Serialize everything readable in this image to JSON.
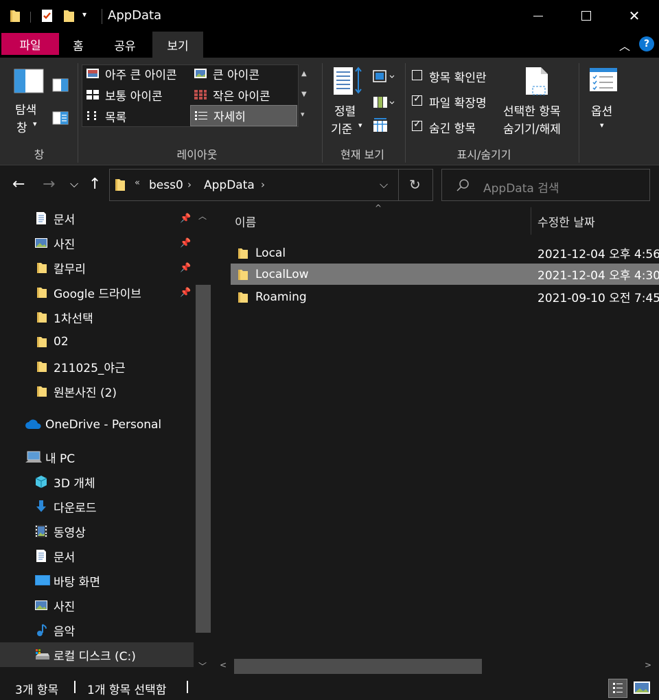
{
  "window": {
    "title": "AppData"
  },
  "ribbon_tabs": {
    "file": "파일",
    "home": "홈",
    "share": "공유",
    "view": "보기"
  },
  "ribbon": {
    "pane": {
      "label_line1": "탐색",
      "label_line2": "창",
      "group": "창"
    },
    "layout": {
      "group": "레이아웃",
      "items": [
        "아주 큰 아이콘",
        "큰 아이콘",
        "보통 아이콘",
        "작은 아이콘",
        "목록",
        "자세히"
      ],
      "selected": "자세히"
    },
    "current_view": {
      "sort_line1": "정렬",
      "sort_line2": "기준",
      "group": "현재 보기"
    },
    "show_hide": {
      "group": "표시/숨기기",
      "checkboxes": [
        {
          "label": "항목 확인란",
          "checked": false
        },
        {
          "label": "파일 확장명",
          "checked": true
        },
        {
          "label": "숨긴 항목",
          "checked": true
        }
      ],
      "hide_selected_line1": "선택한 항목",
      "hide_selected_line2": "숨기기/해제"
    },
    "options": {
      "label": "옵션"
    }
  },
  "address": {
    "overflow": "«",
    "crumbs": [
      "bess0",
      "AppData"
    ],
    "search_placeholder": "AppData 검색"
  },
  "nav": {
    "quick_access": [
      {
        "label": "문서",
        "icon": "document-icon",
        "pinned": true
      },
      {
        "label": "사진",
        "icon": "pictures-icon",
        "pinned": true
      },
      {
        "label": "칼무리",
        "icon": "folder-icon",
        "pinned": true
      },
      {
        "label": "Google 드라이브",
        "icon": "folder-icon",
        "pinned": true
      },
      {
        "label": "1차선택",
        "icon": "folder-icon",
        "pinned": false
      },
      {
        "label": "02",
        "icon": "folder-icon",
        "pinned": false
      },
      {
        "label": "211025_야근",
        "icon": "folder-icon",
        "pinned": false
      },
      {
        "label": "원본사진 (2)",
        "icon": "folder-icon",
        "pinned": false
      }
    ],
    "onedrive": "OneDrive - Personal",
    "this_pc": "내 PC",
    "pc_items": [
      {
        "label": "3D 개체",
        "icon": "3d-objects-icon"
      },
      {
        "label": "다운로드",
        "icon": "downloads-icon"
      },
      {
        "label": "동영상",
        "icon": "videos-icon"
      },
      {
        "label": "문서",
        "icon": "document-icon"
      },
      {
        "label": "바탕 화면",
        "icon": "desktop-icon"
      },
      {
        "label": "사진",
        "icon": "pictures-icon"
      },
      {
        "label": "음악",
        "icon": "music-icon"
      },
      {
        "label": "로컬 디스크 (C:)",
        "icon": "drive-icon"
      }
    ]
  },
  "content": {
    "columns": {
      "name": "이름",
      "modified": "수정한 날짜"
    },
    "rows": [
      {
        "name": "Local",
        "modified": "2021-12-04 오후 4:56",
        "selected": false
      },
      {
        "name": "LocalLow",
        "modified": "2021-12-04 오후 4:30",
        "selected": true
      },
      {
        "name": "Roaming",
        "modified": "2021-09-10 오전 7:45",
        "selected": false
      }
    ]
  },
  "status": {
    "count": "3개 항목",
    "selection": "1개 항목 선택함"
  },
  "colors": {
    "file_tab": "#c30052",
    "accent": "#0f78d4",
    "folder": "#f8d775",
    "selection": "#777777"
  }
}
